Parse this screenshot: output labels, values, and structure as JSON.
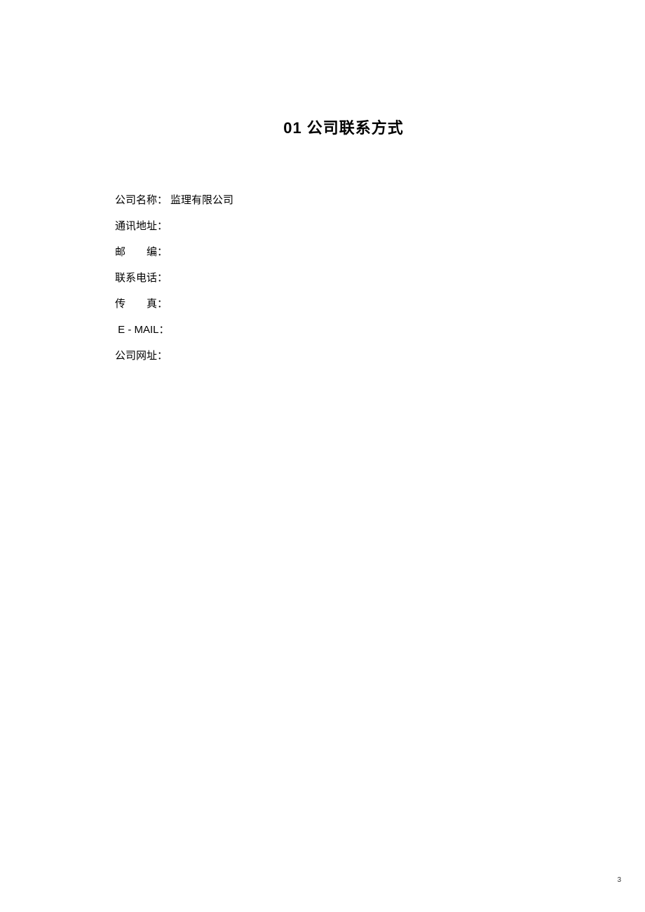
{
  "title": "01 公司联系方式",
  "fields": [
    {
      "label": "公司名称：",
      "value": "监理有限公司"
    },
    {
      "label": "通讯地址：",
      "value": ""
    },
    {
      "label": "邮　　编：",
      "value": ""
    },
    {
      "label": "联系电话：",
      "value": ""
    },
    {
      "label": "传　　真：",
      "value": ""
    },
    {
      "label": " E - MAIL：",
      "value": ""
    },
    {
      "label": "公司网址：",
      "value": ""
    }
  ],
  "page_number": "3"
}
